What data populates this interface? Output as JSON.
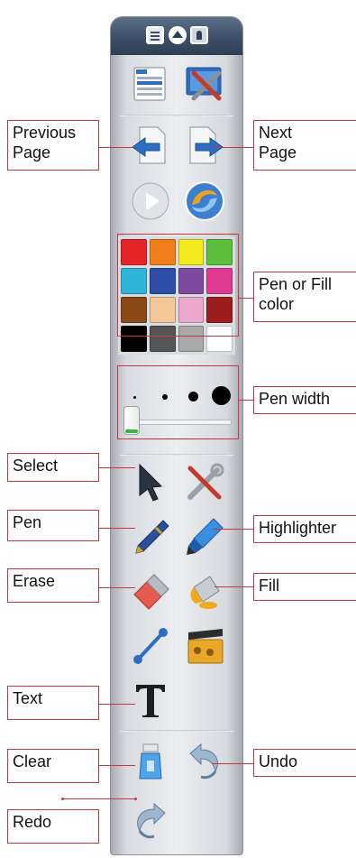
{
  "toolbar": {
    "titlebar_icons": [
      "document-icon",
      "collapse-up-icon",
      "pin-icon"
    ],
    "colors": [
      "#e52428",
      "#f07e1a",
      "#f2ea1d",
      "#5cbf3c",
      "#2fb5d8",
      "#2d4fa8",
      "#7c4a9e",
      "#e13b91",
      "#8a4a17",
      "#f5c89a",
      "#eba8cc",
      "#9b1d1d",
      "#000000",
      "#555555",
      "#aaaaaa",
      "#ffffff"
    ],
    "pen_width_selected": 0
  },
  "callouts": {
    "previous_page": "Previous\nPage",
    "next_page": "Next\nPage",
    "pen_or_fill_color": "Pen or Fill\ncolor",
    "pen_width": "Pen width",
    "select": "Select",
    "pen": "Pen",
    "highlighter": "Highlighter",
    "erase": "Erase",
    "fill": "Fill",
    "text": "Text",
    "clear": "Clear",
    "undo": "Undo",
    "redo": "Redo"
  }
}
